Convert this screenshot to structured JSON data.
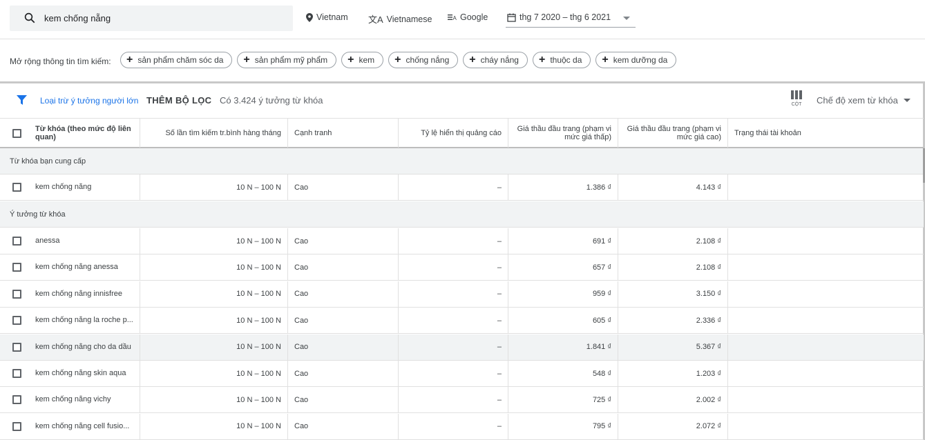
{
  "search": {
    "query": "kem chống nẵng"
  },
  "top_bar": {
    "location": "Vietnam",
    "language": "Vietnamese",
    "network": "Google",
    "date_range": "thg 7 2020 – thg 6 2021"
  },
  "expand": {
    "label": "Mở rộng thông tin tìm kiếm:",
    "chips": [
      "sản phẩm chăm sóc da",
      "sản phẩm mỹ phẩm",
      "kem",
      "chống nắng",
      "cháy nắng",
      "thuộc da",
      "kem dưỡng da"
    ]
  },
  "filter_bar": {
    "exclude_adult": "Loại trừ ý tưởng người lớn",
    "add_filter": "THÊM BỘ LỌC",
    "count": "Có 3.424 ý tưởng từ khóa",
    "columns_label": "CỘT",
    "view_mode": "Chế độ xem từ khóa"
  },
  "table": {
    "headers": {
      "keyword": "Từ khóa (theo mức độ liên quan)",
      "searches": "Số lần tìm kiếm tr.bình hàng tháng",
      "competition": "Cạnh tranh",
      "impression_share": "Tỷ lệ hiển thị quảng cáo",
      "bid_low": "Giá thầu đầu trang (phạm vi mức giá thấp)",
      "bid_high": "Giá thầu đầu trang (phạm vi mức giá cao)",
      "account_status": "Trạng thái tài khoản"
    },
    "group_provided": "Từ khóa bạn cung cấp",
    "group_ideas": "Ý tưởng từ khóa",
    "provided_rows": [
      {
        "keyword": "kem chống nẵng",
        "searches": "10 N – 100 N",
        "competition": "Cao",
        "impression": "–",
        "bid_low": "1.386 ₫",
        "bid_high": "4.143 ₫"
      }
    ],
    "idea_rows": [
      {
        "keyword": "anessa",
        "searches": "10 N – 100 N",
        "competition": "Cao",
        "impression": "–",
        "bid_low": "691 ₫",
        "bid_high": "2.108 ₫"
      },
      {
        "keyword": "kem chống nắng anessa",
        "searches": "10 N – 100 N",
        "competition": "Cao",
        "impression": "–",
        "bid_low": "657 ₫",
        "bid_high": "2.108 ₫"
      },
      {
        "keyword": "kem chống nắng innisfree",
        "searches": "10 N – 100 N",
        "competition": "Cao",
        "impression": "–",
        "bid_low": "959 ₫",
        "bid_high": "3.150 ₫"
      },
      {
        "keyword": "kem chống nắng la roche p...",
        "searches": "10 N – 100 N",
        "competition": "Cao",
        "impression": "–",
        "bid_low": "605 ₫",
        "bid_high": "2.336 ₫"
      },
      {
        "keyword": "kem chống nắng cho da dầu",
        "searches": "10 N – 100 N",
        "competition": "Cao",
        "impression": "–",
        "bid_low": "1.841 ₫",
        "bid_high": "5.367 ₫"
      },
      {
        "keyword": "kem chống nắng skin aqua",
        "searches": "10 N – 100 N",
        "competition": "Cao",
        "impression": "–",
        "bid_low": "548 ₫",
        "bid_high": "1.203 ₫"
      },
      {
        "keyword": "kem chống nắng vichy",
        "searches": "10 N – 100 N",
        "competition": "Cao",
        "impression": "–",
        "bid_low": "725 ₫",
        "bid_high": "2.002 ₫"
      },
      {
        "keyword": "kem chống nắng cell fusio...",
        "searches": "10 N – 100 N",
        "competition": "Cao",
        "impression": "–",
        "bid_low": "795 ₫",
        "bid_high": "2.072 ₫"
      }
    ]
  },
  "colors": {
    "link": "#1a73e8",
    "chip_border": "#9aa0a6",
    "group_bg": "#f1f3f4"
  }
}
